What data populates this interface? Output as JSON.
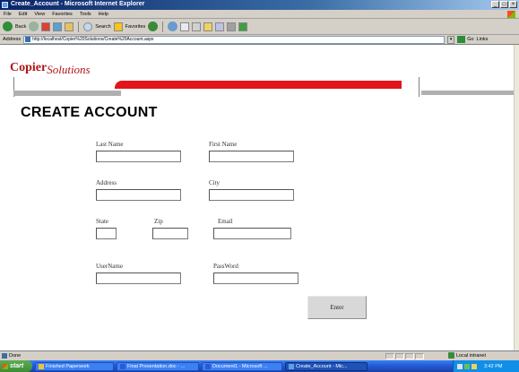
{
  "window": {
    "title": "Create_Account - Microsoft Internet Explorer",
    "controls": [
      "_",
      "□",
      "×"
    ]
  },
  "menu": [
    "File",
    "Edit",
    "View",
    "Favorites",
    "Tools",
    "Help"
  ],
  "toolbar": {
    "back": "Back",
    "search": "Search",
    "favorites": "Favorites"
  },
  "address": {
    "label": "Address",
    "url": "http://localhost/Copier%20Solutions/Create%20Account.aspx",
    "go": "Go",
    "links": "Links"
  },
  "page": {
    "logo_main": "Copier",
    "logo_sub": "Solutions",
    "title": "CREATE ACCOUNT",
    "fields": {
      "last_name": "Last Name",
      "first_name": "First Name",
      "address": "Address",
      "city": "City",
      "state": "State",
      "zip": "Zip",
      "email": "Email",
      "username": "UserName",
      "password": "PassWord"
    },
    "submit": "Enter",
    "colors": {
      "brand_red": "#e0161b",
      "logo_red": "#b21416"
    }
  },
  "status": {
    "text": "Done",
    "zone": "Local intranet"
  },
  "taskbar": {
    "start": "start",
    "tasks": [
      "Finished Paperwork",
      "Final Presentation.doc - ...",
      "Document1 - Microsoft ...",
      "Create_Account - Mic..."
    ],
    "clock": "3:42 PM"
  }
}
